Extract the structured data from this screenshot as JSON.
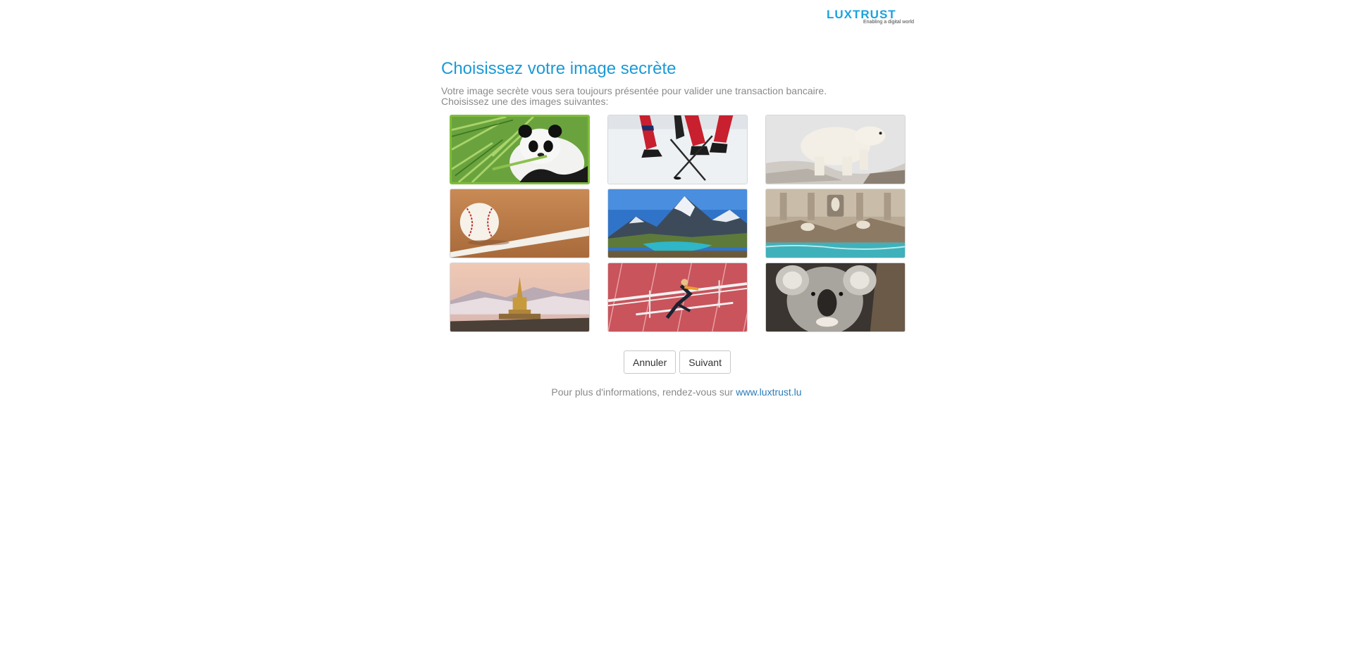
{
  "logo": {
    "text": "LUXTRUST",
    "tagline": "Enabling a digital world"
  },
  "title": "Choisissez votre image secrète",
  "subtitle": {
    "line1": "Votre image secrète vous sera toujours présentée pour valider une transaction bancaire.",
    "line2": "Choisissez une des images suivantes:"
  },
  "images": [
    {
      "subject": "panda",
      "selected": true
    },
    {
      "subject": "ice-hockey",
      "selected": false
    },
    {
      "subject": "polar-bear",
      "selected": false
    },
    {
      "subject": "baseball",
      "selected": false
    },
    {
      "subject": "mountain-lake",
      "selected": false
    },
    {
      "subject": "fountain",
      "selected": false
    },
    {
      "subject": "stupa",
      "selected": false
    },
    {
      "subject": "hurdles",
      "selected": false
    },
    {
      "subject": "koala",
      "selected": false
    }
  ],
  "buttons": {
    "cancel": "Annuler",
    "next": "Suivant"
  },
  "footer": {
    "text": "Pour plus d'informations, rendez-vous sur",
    "link": "www.luxtrust.lu"
  },
  "colors": {
    "accent": "#1a9ad6",
    "selected_border": "#7fbd3a",
    "link": "#2a7bb8"
  }
}
